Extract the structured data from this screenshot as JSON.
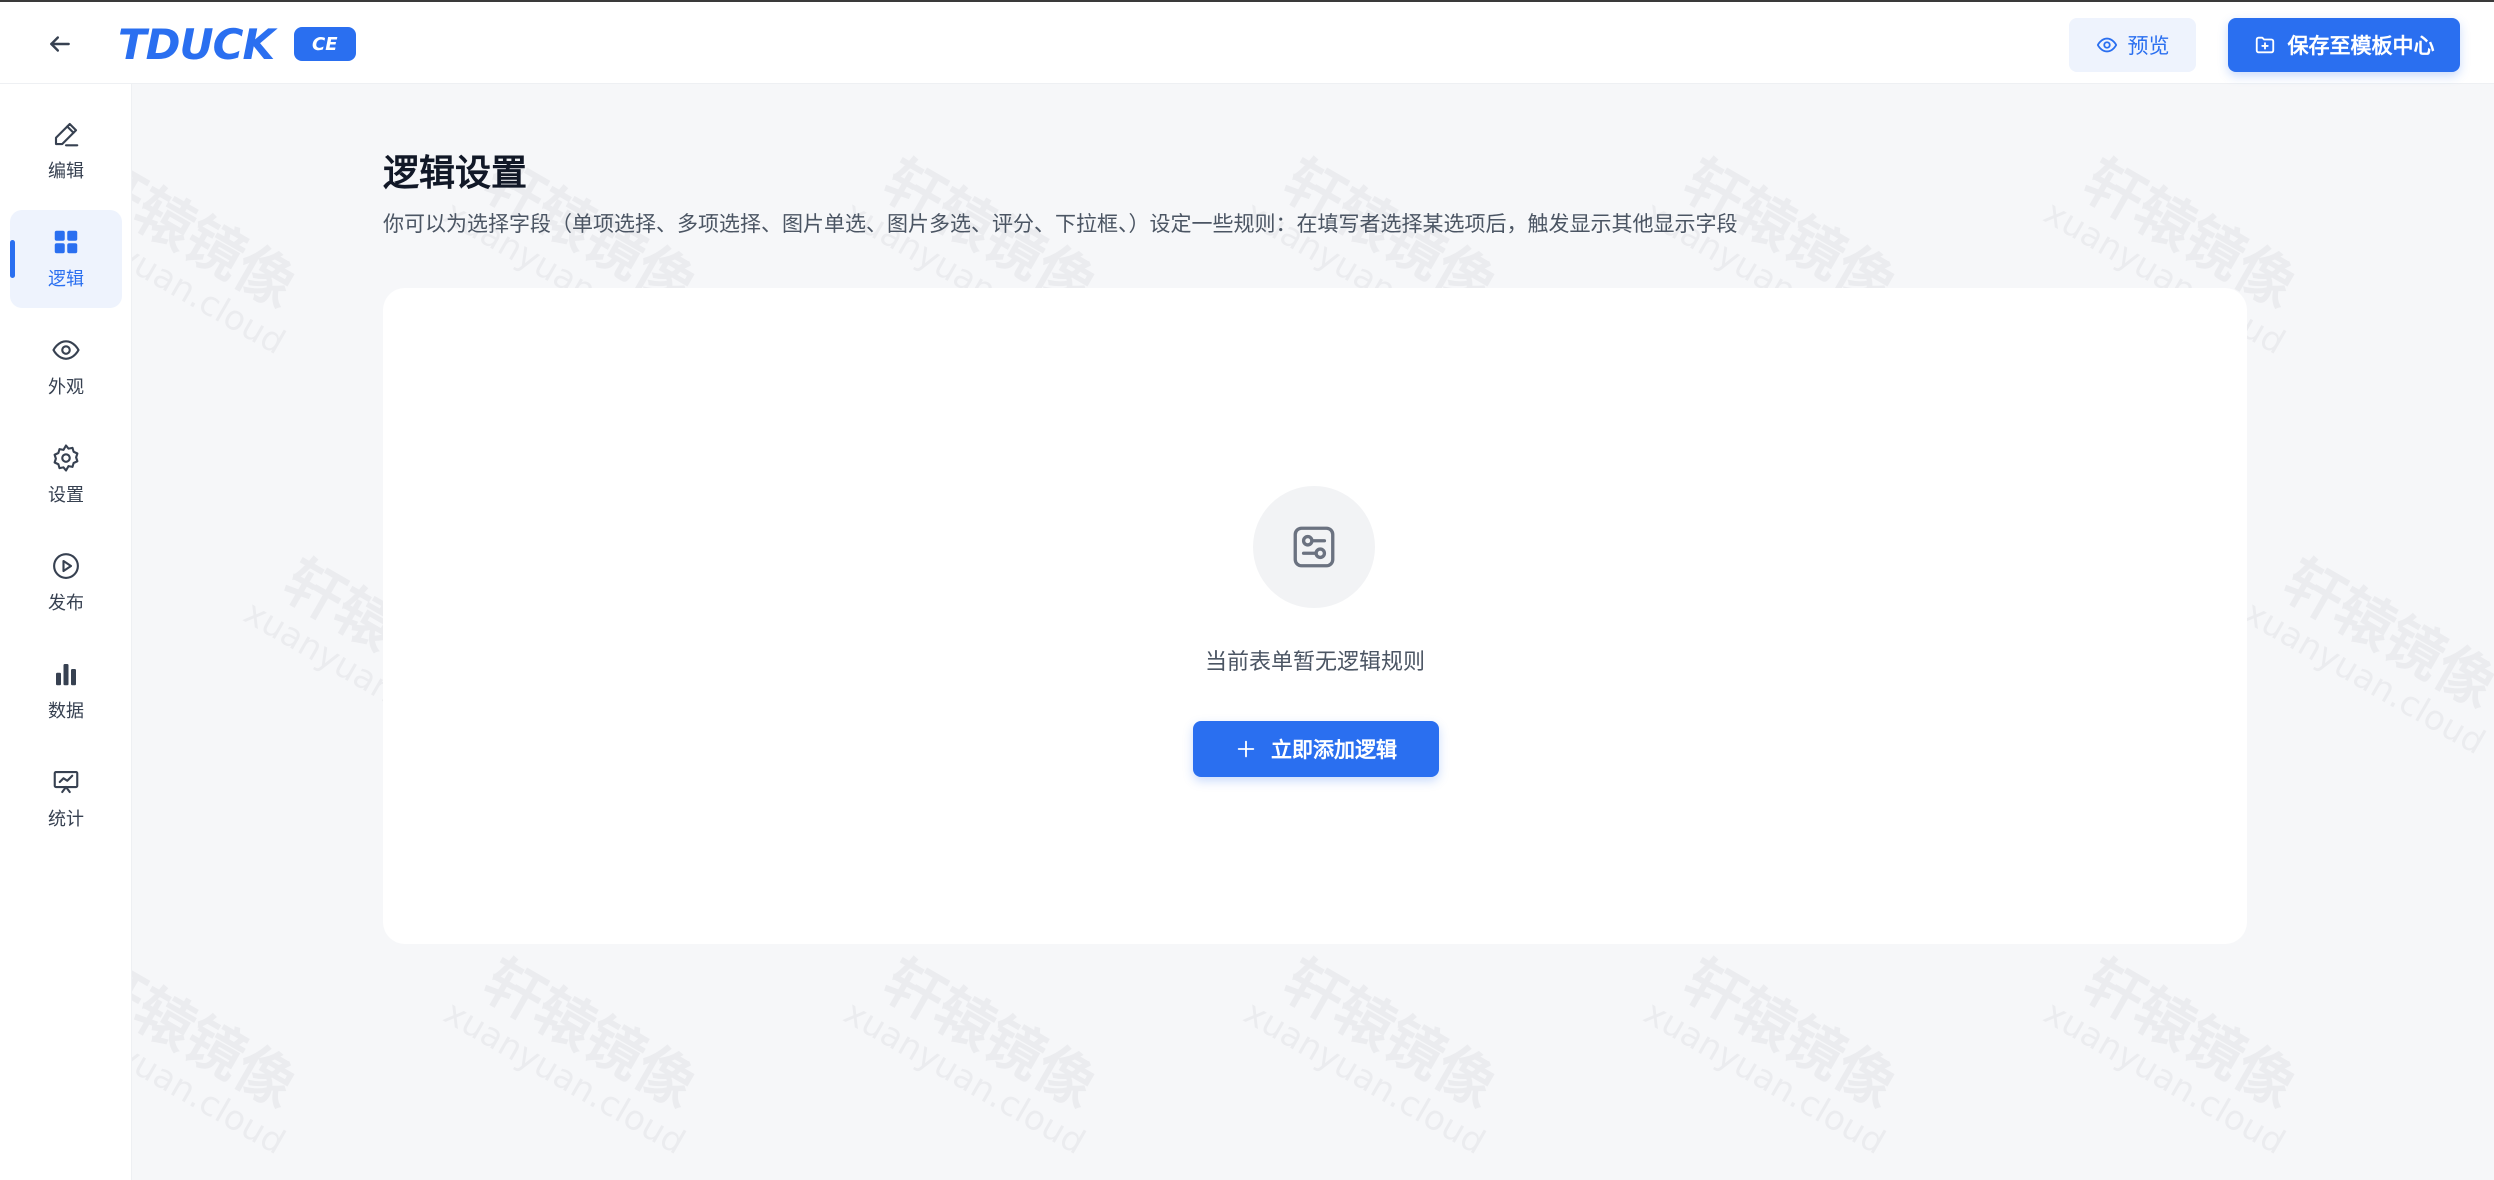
{
  "header": {
    "logo_text": "TDUCK",
    "logo_badge": "CE",
    "preview_label": "预览",
    "save_label": "保存至模板中心"
  },
  "sidebar": {
    "items": [
      {
        "label": "编辑",
        "icon": "edit-icon"
      },
      {
        "label": "逻辑",
        "icon": "grid-icon",
        "active": true
      },
      {
        "label": "外观",
        "icon": "eye-icon"
      },
      {
        "label": "设置",
        "icon": "gear-icon"
      },
      {
        "label": "发布",
        "icon": "play-circle-icon"
      },
      {
        "label": "数据",
        "icon": "bar-chart-icon"
      },
      {
        "label": "统计",
        "icon": "presentation-icon"
      }
    ]
  },
  "main": {
    "title": "逻辑设置",
    "description": "你可以为选择字段（单项选择、多项选择、图片单选、图片多选、评分、下拉框、）设定一些规则：在填写者选择某选项后，触发显示其他显示字段",
    "empty_text": "当前表单暂无逻辑规则",
    "add_button_label": "立即添加逻辑"
  },
  "watermark": {
    "cn": "轩辕镜像",
    "en": "xuanyuan.cloud"
  },
  "colors": {
    "accent": "#2a6ff0",
    "background": "#f6f7f9"
  }
}
